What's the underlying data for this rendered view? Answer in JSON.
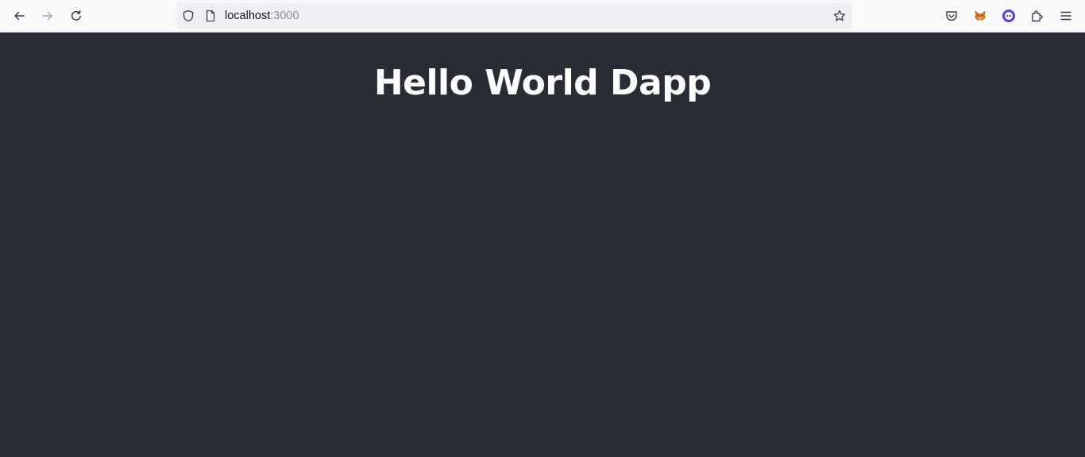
{
  "browser": {
    "url_host": "localhost",
    "url_port": ":3000",
    "icons": {
      "back": "arrow-left-icon",
      "forward": "arrow-right-icon",
      "reload": "reload-icon",
      "tracking": "shield-icon",
      "page": "document-icon",
      "bookmark": "star-icon",
      "pocket": "pocket-icon",
      "metamask": "fox-icon",
      "extension2": "circle-face-icon",
      "extensions": "puzzle-icon",
      "menu": "hamburger-icon"
    },
    "colors": {
      "toolbar": "#f9f9fb",
      "urlbar": "#f0f0f4",
      "metamask_orange": "#e2761b",
      "extension_purple": "#5a3fd6"
    }
  },
  "page": {
    "heading": "Hello World Dapp",
    "background": "#282c34",
    "text_color": "#ffffff"
  }
}
